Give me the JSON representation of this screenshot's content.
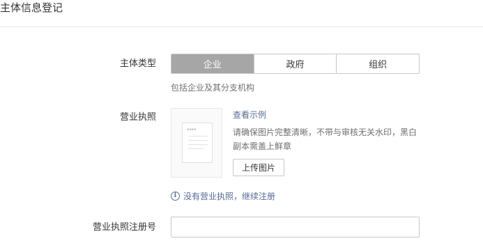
{
  "page": {
    "title": "主体信息登记"
  },
  "entity_type": {
    "label": "主体类型",
    "options": [
      "企业",
      "政府",
      "组织"
    ],
    "selected": "企业",
    "hint": "包括企业及其分支机构"
  },
  "license": {
    "label": "营业执照",
    "view_example": "查看示例",
    "description": "请确保图片完整清晰，不带与审核无关水印，黑白副本需盖上鲜章",
    "upload_button": "上传图片",
    "no_license_link": "没有营业执照，继续注册",
    "info_icon": "info-circle-icon"
  },
  "license_number": {
    "label": "营业执照注册号",
    "value": "",
    "placeholder": ""
  },
  "colors": {
    "active_segment": "#a6a6a6",
    "link": "#576b95",
    "border": "#c8c8c8"
  }
}
